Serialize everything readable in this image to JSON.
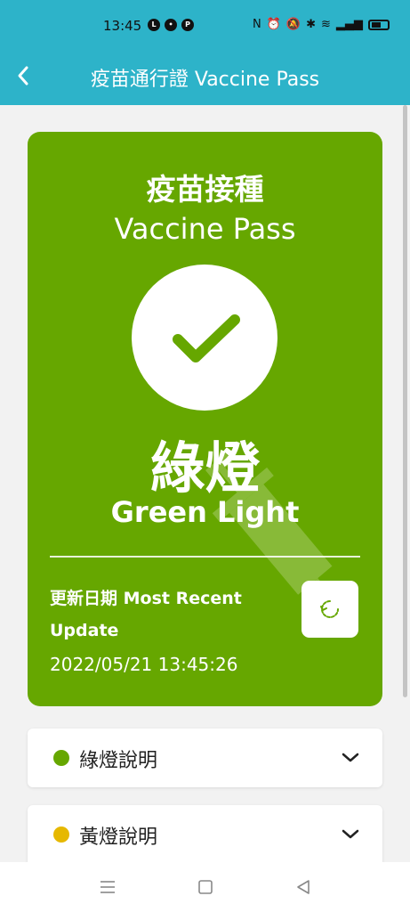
{
  "status_bar": {
    "time": "13:45",
    "left_icons": [
      "line-icon",
      "messenger-icon",
      "p-app-icon"
    ],
    "right_icons": [
      "nfc-icon",
      "alarm-icon",
      "mute-icon",
      "bluetooth-icon",
      "wifi-icon",
      "signal-icon",
      "battery-icon"
    ]
  },
  "header": {
    "title": "疫苗通行證 Vaccine Pass",
    "back_icon": "chevron-left-icon"
  },
  "pass_card": {
    "title_zh": "疫苗接種",
    "title_en": "Vaccine Pass",
    "status_zh": "綠燈",
    "status_en": "Green Light",
    "update_label": "更新日期 Most Recent Update",
    "update_time": "2022/05/21 13:45:26",
    "refresh_icon": "refresh-icon",
    "color": "#66a700"
  },
  "info_sections": [
    {
      "label": "綠燈說明",
      "color": "#66a700",
      "icon": "chevron-down-icon"
    },
    {
      "label": "黃燈說明",
      "color": "#e6b800",
      "icon": "chevron-down-icon"
    }
  ],
  "nav_bar": {
    "icons": [
      "menu-icon",
      "home-square-icon",
      "back-triangle-icon"
    ]
  },
  "colors": {
    "header": "#2db3c9",
    "green": "#66a700",
    "yellow": "#e6b800"
  }
}
